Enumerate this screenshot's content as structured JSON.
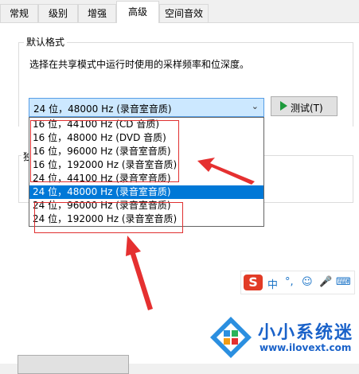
{
  "tabs": [
    {
      "label": "常规"
    },
    {
      "label": "级别"
    },
    {
      "label": "增强"
    },
    {
      "label": "高级"
    },
    {
      "label": "空间音效"
    }
  ],
  "active_tab": "高级",
  "default_format": {
    "title": "默认格式",
    "description": "选择在共享模式中运行时使用的采样频率和位深度。",
    "selected": "24 位，48000 Hz (录音室音质)",
    "test_label": "测试(T)"
  },
  "dropdown": {
    "options": [
      "16 位，44100 Hz (CD 音质)",
      "16 位，48000 Hz (DVD 音质)",
      "16 位，96000 Hz (录音室音质)",
      "16 位，192000 Hz (录音室音质)",
      "24 位，44100 Hz (录音室音质)",
      "24 位，48000 Hz (录音室音质)",
      "24 位，96000 Hz (录音室音质)",
      "24 位，192000 Hz (录音室音质)"
    ],
    "selected_index": 5
  },
  "exclusive_label_fragment": "独",
  "ime": {
    "logo": "S",
    "items": [
      "中",
      "°,",
      "☺",
      "🎤",
      "⌨"
    ]
  },
  "watermark": {
    "title": "小小系统迷",
    "url": "www.ilovext.com"
  },
  "colors": {
    "selection": "#0078d7",
    "annotation_red": "#e03030",
    "brand_blue": "#1a62c9"
  }
}
